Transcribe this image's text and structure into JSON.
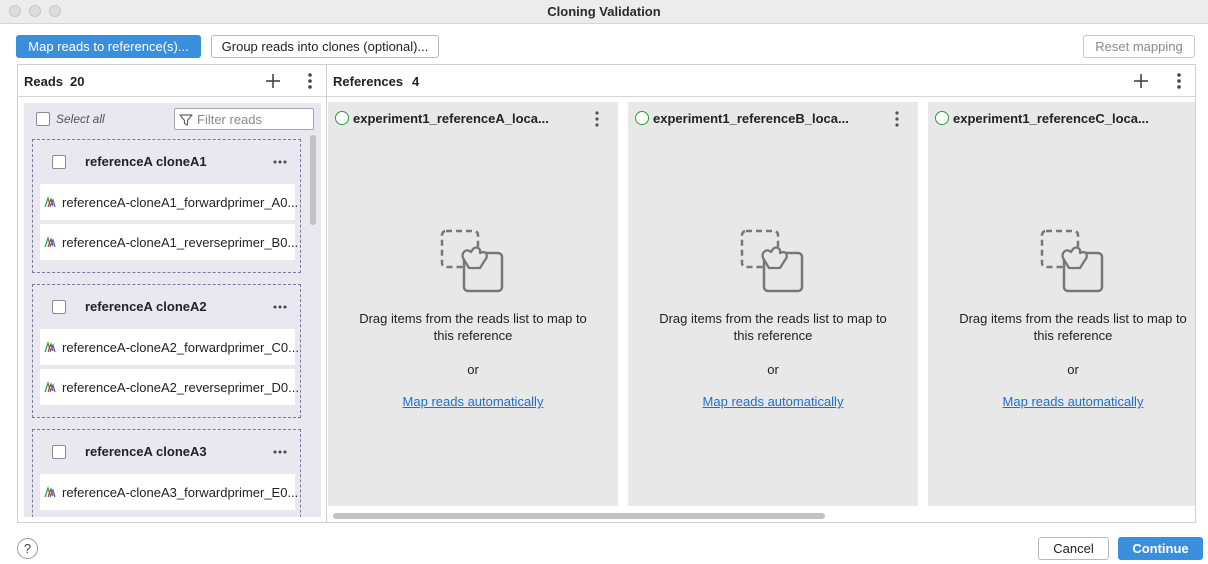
{
  "window": {
    "title": "Cloning Validation"
  },
  "toolbar": {
    "map_reads_label": "Map reads to reference(s)...",
    "group_reads_label": "Group reads into clones (optional)...",
    "reset_mapping_label": "Reset mapping"
  },
  "reads": {
    "title": "Reads",
    "count": "20",
    "select_all_label": "Select all",
    "filter_placeholder": "Filter reads",
    "groups": [
      {
        "name": "referenceA cloneA1",
        "reads": [
          "referenceA-cloneA1_forwardprimer_A0...",
          "referenceA-cloneA1_reverseprimer_B0..."
        ]
      },
      {
        "name": "referenceA cloneA2",
        "reads": [
          "referenceA-cloneA2_forwardprimer_C0...",
          "referenceA-cloneA2_reverseprimer_D0..."
        ]
      },
      {
        "name": "referenceA cloneA3",
        "reads": [
          "referenceA-cloneA3_forwardprimer_E0..."
        ]
      }
    ]
  },
  "references": {
    "title": "References",
    "count": "4",
    "items": [
      {
        "name": "experiment1_referenceA_loca...",
        "drag_text": "Drag items from the reads list to map to this reference",
        "or_text": "or",
        "link_label": "Map reads automatically"
      },
      {
        "name": "experiment1_referenceB_loca...",
        "drag_text": "Drag items from the reads list to map to this reference",
        "or_text": "or",
        "link_label": "Map reads automatically"
      },
      {
        "name": "experiment1_referenceC_loca...",
        "drag_text": "Drag items from the reads list to map to this reference",
        "or_text": "or",
        "link_label": "Map reads automatically"
      }
    ]
  },
  "footer": {
    "help_label": "?",
    "cancel_label": "Cancel",
    "continue_label": "Continue"
  },
  "colors": {
    "primary": "#3a8fdc",
    "link": "#1f6fd0",
    "status_ok": "#2a9d3a",
    "reads_background": "#e9e8f1",
    "reference_background": "#e8e8e8"
  }
}
